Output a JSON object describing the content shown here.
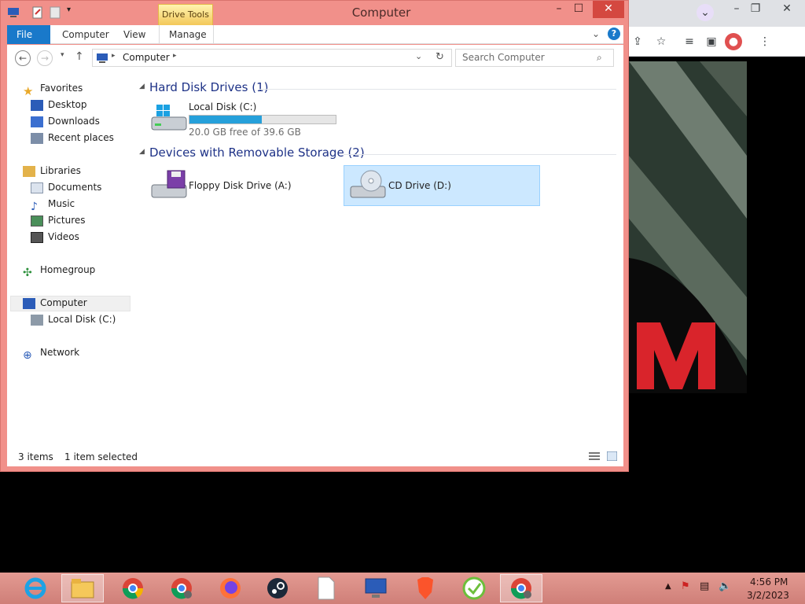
{
  "explorer": {
    "title": "Computer",
    "contextual_tab": "Drive Tools",
    "ribbon_tabs": [
      "File",
      "Computer",
      "View",
      "Manage"
    ],
    "address_path": "Computer",
    "search_placeholder": "Search Computer",
    "nav": {
      "favorites": "Favorites",
      "desktop": "Desktop",
      "downloads": "Downloads",
      "recent": "Recent places",
      "libraries": "Libraries",
      "documents": "Documents",
      "music": "Music",
      "pictures": "Pictures",
      "videos": "Videos",
      "homegroup": "Homegroup",
      "computer": "Computer",
      "local_disk": "Local Disk (C:)",
      "network": "Network"
    },
    "groups": {
      "hard_disks": "Hard Disk Drives (1)",
      "removable": "Devices with Removable Storage (2)"
    },
    "drives": {
      "c_name": "Local Disk (C:)",
      "c_free": "20.0 GB free of 39.6 GB",
      "c_used_fraction": 0.495,
      "floppy": "Floppy Disk Drive (A:)",
      "cd": "CD Drive (D:)"
    },
    "status": {
      "items": "3 items",
      "selected": "1 item selected"
    }
  },
  "taskbar": {
    "clock_time": "4:56 PM",
    "clock_date": "3/2/2023"
  },
  "colors": {
    "accent": "#1979ca",
    "window_frame": "#f1908a",
    "progress": "#26a0da",
    "selection": "#cce8ff"
  }
}
